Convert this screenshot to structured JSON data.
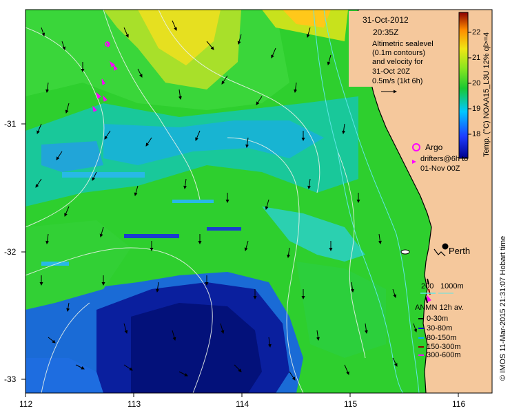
{
  "info": {
    "date": "31-Oct-2012",
    "time": "20:35Z",
    "description": [
      "Altimetric sealevel",
      "(0.1m contours)",
      "and velocity for",
      "31-Oct 20Z",
      "0.5m/s (1kt 6h)"
    ]
  },
  "argo_label": "Argo",
  "drifters_label": [
    "drifters@6h to",
    "01-Nov 00Z"
  ],
  "city": "Perth",
  "depth_legend": {
    "a": "200",
    "b": "1000m"
  },
  "anmn": {
    "title": "ANMN 12h av.",
    "rows": [
      {
        "label": "0-30m",
        "color": "#000000"
      },
      {
        "label": "30-80m",
        "color": "#0000cc"
      },
      {
        "label": "80-150m",
        "color": "#00aaff"
      },
      {
        "label": "150-300m",
        "color": "#8b0000"
      },
      {
        "label": "300-600m",
        "color": "#ff00ff"
      }
    ]
  },
  "colorbar": {
    "label": "Temp. (°C) NOAA15_L3U 12% ql>=4",
    "ticks": [
      "22",
      "21",
      "20",
      "19",
      "18"
    ]
  },
  "credit": "© IMOS 11-Mar-2015 21:31:07 Hobart time",
  "axes": {
    "x_ticks": [
      "112",
      "113",
      "114",
      "115",
      "116"
    ],
    "y_ticks": [
      "-31",
      "-32",
      "-33"
    ]
  }
}
